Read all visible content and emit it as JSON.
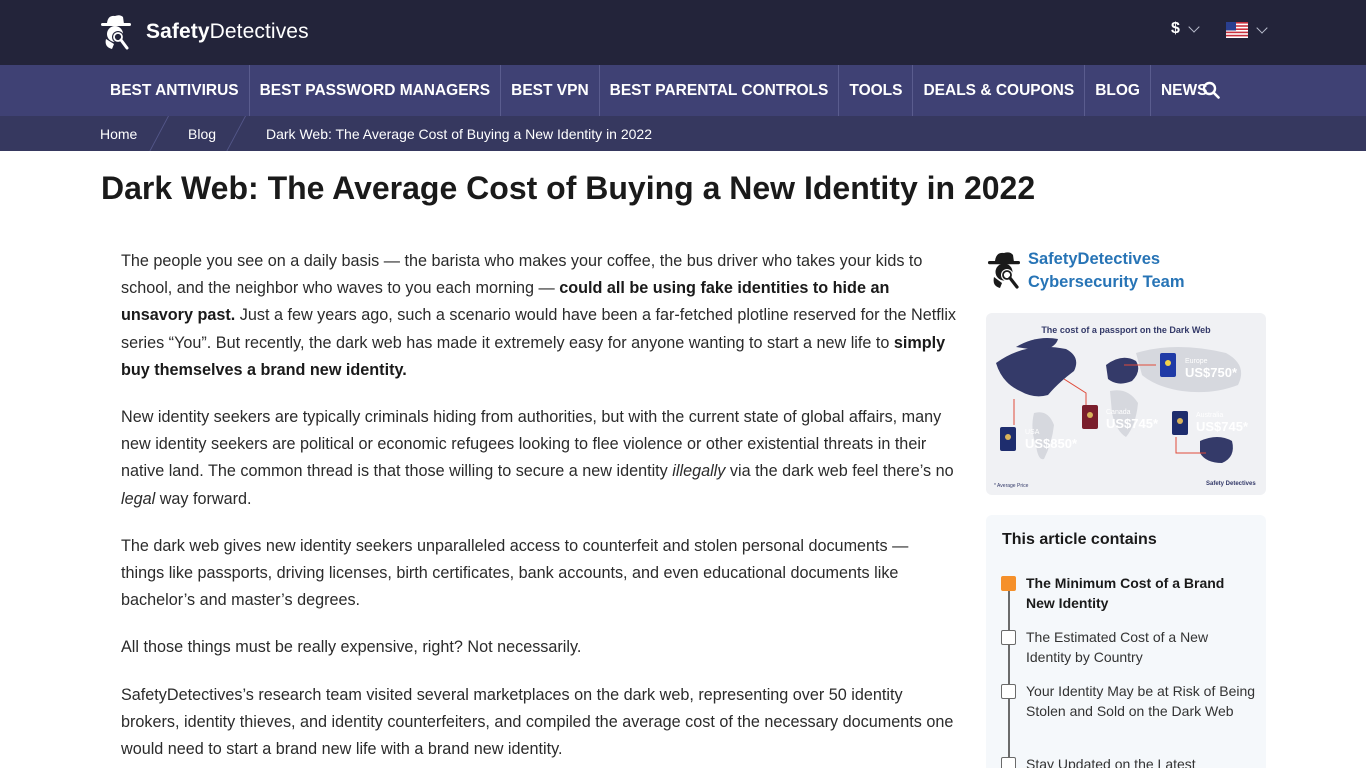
{
  "header": {
    "logo": {
      "bold": "Safety",
      "regular": "Detectives"
    },
    "currency": "$",
    "language_icon": "us-flag-icon"
  },
  "nav": {
    "items": [
      "BEST ANTIVIRUS",
      "BEST PASSWORD MANAGERS",
      "BEST VPN",
      "BEST PARENTAL CONTROLS",
      "TOOLS",
      "DEALS & COUPONS",
      "BLOG",
      "NEWS"
    ],
    "search_icon": "search-icon"
  },
  "breadcrumb": [
    "Home",
    "Blog",
    "Dark Web: The Average Cost of Buying a New Identity in 2022"
  ],
  "title": "Dark Web: The Average Cost of Buying a New Identity in 2022",
  "article": {
    "p1": {
      "a": "The people you see on a daily basis — the barista who makes your coffee, the bus driver who takes your kids to school, and the neighbor who waves to you each morning — ",
      "b": "could all be using fake identities to hide an unsavory past.",
      "c": " Just a few years ago, such a scenario would have been a far-fetched plotline reserved for the Netflix series “You”. But recently, the dark web has made it extremely easy for anyone wanting to start a new life to ",
      "d": "simply buy themselves a brand new identity."
    },
    "p2": {
      "a": "New identity seekers are typically criminals hiding from authorities, but with the current state of global affairs, many new identity seekers are political or economic refugees looking to flee violence or other existential threats in their native land. The common thread is that those willing to secure a new identity ",
      "b": "illegally",
      "c": " via the dark web feel there’s no ",
      "d": "legal",
      "e": " way forward."
    },
    "p3": "The dark web gives new identity seekers unparalleled access to counterfeit and stolen personal documents — things like passports, driving licenses, birth certificates, bank accounts, and even educational documents like bachelor’s and master’s degrees.",
    "p4": "All those things must be really expensive, right? Not necessarily.",
    "p5": "SafetyDetectives’s research team visited several marketplaces on the dark web, representing over 50 identity brokers, identity thieves, and identity counterfeiters, and compiled the average cost of the necessary documents one would need to start a brand new life with a brand new identity."
  },
  "author": {
    "line1": "SafetyDetectives",
    "line2": "Cybersecurity Team"
  },
  "infographic": {
    "title": "The cost of a passport on the Dark Web",
    "prices": [
      {
        "country": "Europe",
        "price": "US$750*"
      },
      {
        "country": "Canada",
        "price": "US$745*"
      },
      {
        "country": "Australia",
        "price": "US$745*"
      },
      {
        "country": "USA",
        "price": "US$850*"
      }
    ],
    "legend": "* Average Price",
    "brand": "Safety Detectives",
    "colors": {
      "map": "#343a69",
      "connector": "#e04b3a",
      "land": "#d6d8de"
    }
  },
  "toc": {
    "title": "This article contains",
    "items": [
      "The Minimum Cost of a Brand New Identity",
      "The Estimated Cost of a New Identity by Country",
      "Your Identity May be at Risk of Being Stolen and Sold on the Dark Web",
      "Stay Updated on the Latest"
    ],
    "active_color": "#f5902b"
  },
  "colors": {
    "topbar": "#23243a",
    "navbar": "#3f4174",
    "breadcrumb_bar": "#36385f",
    "link": "#2774b6"
  }
}
